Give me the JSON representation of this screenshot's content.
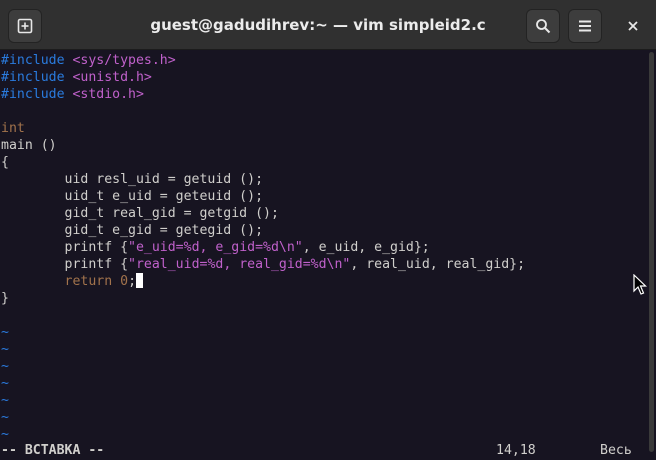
{
  "window": {
    "title": "guest@gadudihrev:~ — vim simpleid2.c",
    "icons": {
      "new_tab": "new-tab-icon",
      "search": "search-icon",
      "menu": "hamburger-menu-icon",
      "close": "close-icon"
    }
  },
  "editor": {
    "lines": [
      {
        "pp": "#include ",
        "str": "<sys/types.h>"
      },
      {
        "pp": "#include ",
        "str": "<unistd.h>"
      },
      {
        "pp": "#include ",
        "str": "<stdio.h>"
      },
      {
        "text": ""
      },
      {
        "kw": "int"
      },
      {
        "text": "main ()"
      },
      {
        "text": "{"
      },
      {
        "text": "        uid resl_uid = getuid ();"
      },
      {
        "text": "        uid_t e_uid = geteuid ();"
      },
      {
        "text": "        gid_t real_gid = getgid ();"
      },
      {
        "text": "        gid_t e_gid = getegid ();"
      },
      {
        "pre": "        printf {",
        "str": "\"e_uid=%d, e_gid=%d\\n\"",
        "post": ", e_uid, e_gid};"
      },
      {
        "pre": "        printf {",
        "str": "\"real_uid=%d, real_gid=%d\\n\"",
        "post": ", real_uid, real_gid};"
      },
      {
        "pre": "        ",
        "kw": "return ",
        "num": "0",
        "post": ";"
      },
      {
        "text": "}"
      }
    ],
    "empty_marker": "~",
    "empty_lines": 7
  },
  "status": {
    "mode": "-- ВСТАВКА --",
    "position": "14,18",
    "scroll": "Весь"
  },
  "colors": {
    "background": "#171421",
    "preprocessor": "#2a7bde",
    "string": "#c061cb",
    "keyword": "#a2734c",
    "text": "#d0cfcc"
  }
}
